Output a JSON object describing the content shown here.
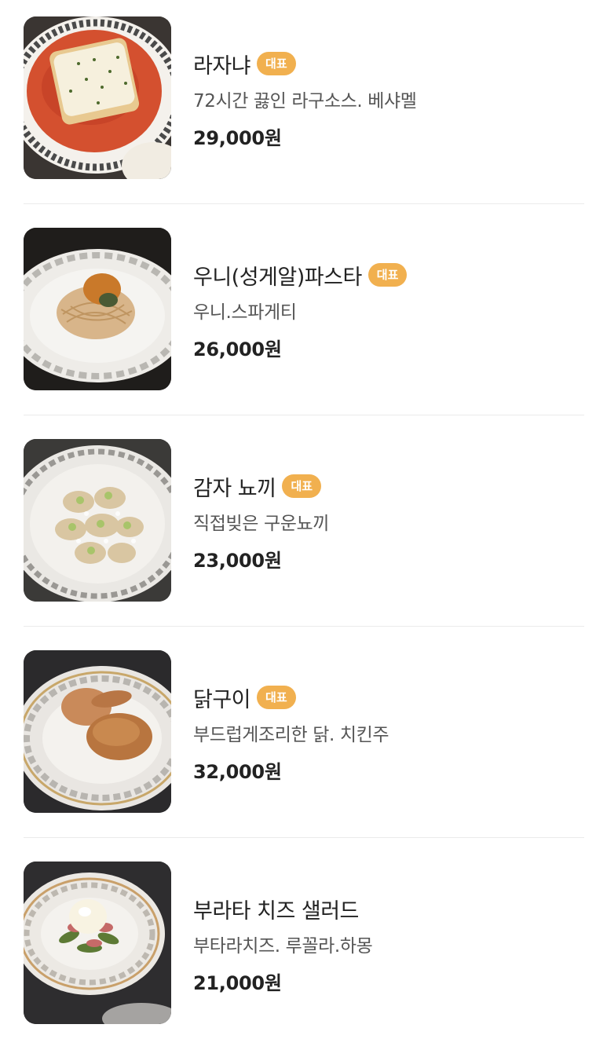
{
  "menu": {
    "items": [
      {
        "name": "라자냐",
        "badge": "대표",
        "description": "72시간 끓인 라구소스. 베샤멜",
        "price": "29,000원",
        "image": "lasagna-photo"
      },
      {
        "name": "우니(성게알)파스타",
        "badge": "대표",
        "description": "우니.스파게티",
        "price": "26,000원",
        "image": "uni-pasta-photo"
      },
      {
        "name": "감자 뇨끼",
        "badge": "대표",
        "description": "직접빚은 구운뇨끼",
        "price": "23,000원",
        "image": "potato-gnocchi-photo"
      },
      {
        "name": "닭구이",
        "badge": "대표",
        "description": "부드럽게조리한 닭. 치킨주",
        "price": "32,000원",
        "image": "roast-chicken-photo"
      },
      {
        "name": "부라타 치즈 샐러드",
        "description": "부타라치즈. 루꼴라.하몽",
        "price": "21,000원",
        "image": "burrata-salad-photo"
      }
    ]
  },
  "colors": {
    "badge_bg": "#f1b04f",
    "divider": "#ebebeb",
    "text": "#222222",
    "subtext": "#555555"
  }
}
